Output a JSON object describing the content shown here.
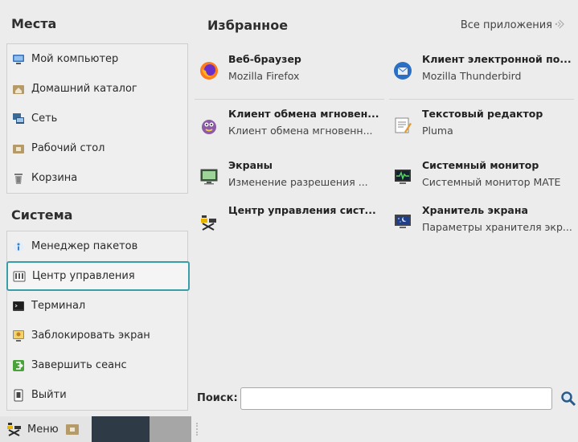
{
  "places": {
    "title": "Места",
    "items": [
      {
        "label": "Мой компьютер",
        "icon": "computer-icon"
      },
      {
        "label": "Домашний каталог",
        "icon": "home-folder-icon"
      },
      {
        "label": "Сеть",
        "icon": "network-icon"
      },
      {
        "label": "Рабочий стол",
        "icon": "desktop-folder-icon"
      },
      {
        "label": "Корзина",
        "icon": "trash-icon"
      }
    ]
  },
  "system": {
    "title": "Система",
    "items": [
      {
        "label": "Менеджер пакетов",
        "icon": "package-manager-icon"
      },
      {
        "label": "Центр управления",
        "icon": "control-center-icon",
        "active": true
      },
      {
        "label": "Терминал",
        "icon": "terminal-icon"
      },
      {
        "label": "Заблокировать экран",
        "icon": "lock-screen-icon"
      },
      {
        "label": "Завершить сеанс",
        "icon": "logout-icon"
      },
      {
        "label": "Выйти",
        "icon": "quit-icon"
      }
    ]
  },
  "favorites": {
    "title": "Избранное",
    "all_apps_label": "Все приложения",
    "apps": [
      {
        "name": "Веб-браузер",
        "desc": "Mozilla Firefox",
        "icon": "firefox-icon"
      },
      {
        "name": "Клиент электронной по...",
        "desc": "Mozilla Thunderbird",
        "icon": "thunderbird-icon"
      },
      {
        "name": "Клиент обмена мгновен...",
        "desc": "Клиент обмена мгновенн...",
        "icon": "pidgin-icon"
      },
      {
        "name": "Текстовый редактор",
        "desc": "Pluma",
        "icon": "text-editor-icon"
      },
      {
        "name": "Экраны",
        "desc": "Изменение разрешения ...",
        "icon": "displays-icon"
      },
      {
        "name": "Системный монитор",
        "desc": "Системный монитор MATE",
        "icon": "system-monitor-icon"
      },
      {
        "name": "Центр управления сист...",
        "desc": "",
        "icon": "alt-control-center-icon"
      },
      {
        "name": "Хранитель экрана",
        "desc": "Параметры хранителя экр...",
        "icon": "screensaver-icon"
      }
    ]
  },
  "search": {
    "label": "Поиск:",
    "value": "",
    "placeholder": ""
  },
  "taskbar": {
    "menu_label": "Меню"
  },
  "colors": {
    "accent": "#3a9ea8",
    "background": "#ececec",
    "taskbar_dark": "#2e3a45"
  }
}
